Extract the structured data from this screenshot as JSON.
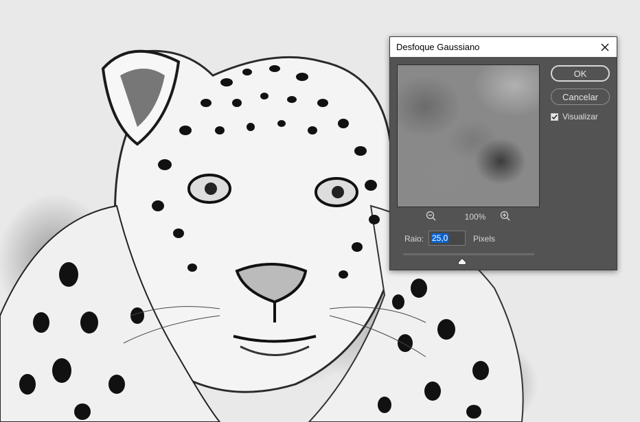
{
  "dialog": {
    "title": "Desfoque Gaussiano",
    "ok_label": "OK",
    "cancel_label": "Cancelar",
    "preview_checkbox": {
      "label": "Visualizar",
      "checked": true
    },
    "zoom_level": "100%",
    "radius": {
      "label": "Raio:",
      "value": "25,0",
      "unit": "Pixels",
      "slider_fraction": 0.45
    }
  },
  "icons": {
    "close": "close-icon",
    "zoom_out": "zoom-out-icon",
    "zoom_in": "zoom-in-icon",
    "check": "check-icon",
    "slider_thumb": "slider-thumb-icon"
  },
  "colors": {
    "dialog_bg": "#535353",
    "titlebar_bg": "#ffffff",
    "selection": "#0a64d0",
    "text": "#d6d6d6"
  }
}
